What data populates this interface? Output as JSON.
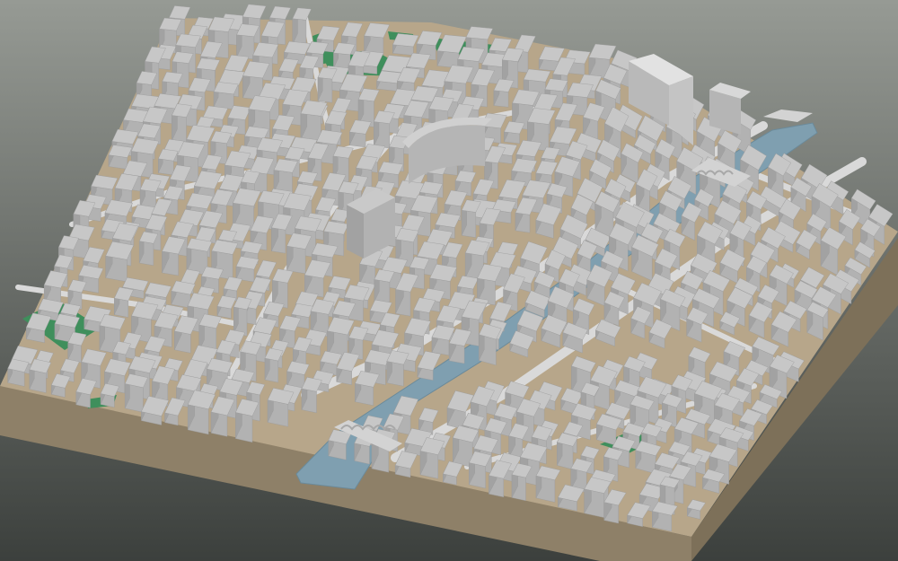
{
  "scene": {
    "type": "3d-city-model",
    "background": {
      "top": "#969a94",
      "bottom": "#3c403d"
    },
    "colors": {
      "base_side": "#8e8068",
      "base_top": "#a7967a",
      "ground": "#b7a68a",
      "street": "#d9d9d9",
      "river": "#7f9fb0",
      "river_edge": "#6b8a9a",
      "park": "#3f8f5c",
      "building_roof": "#c7c7c7",
      "building_side_light": "#b2b2b2",
      "building_side_dark": "#a2a2a2",
      "building_edge": "#9a9a9a",
      "bridge": "#d3d3d3"
    },
    "features": {
      "river": "river-channel",
      "bridges": [
        "bridge-west",
        "bridge-east"
      ],
      "parks": [
        "park-west",
        "park-north-a",
        "park-north-b",
        "park-north-c",
        "park-south"
      ],
      "landmarks": [
        "tower-block",
        "curved-roof-building",
        "white-slab-block"
      ]
    }
  }
}
